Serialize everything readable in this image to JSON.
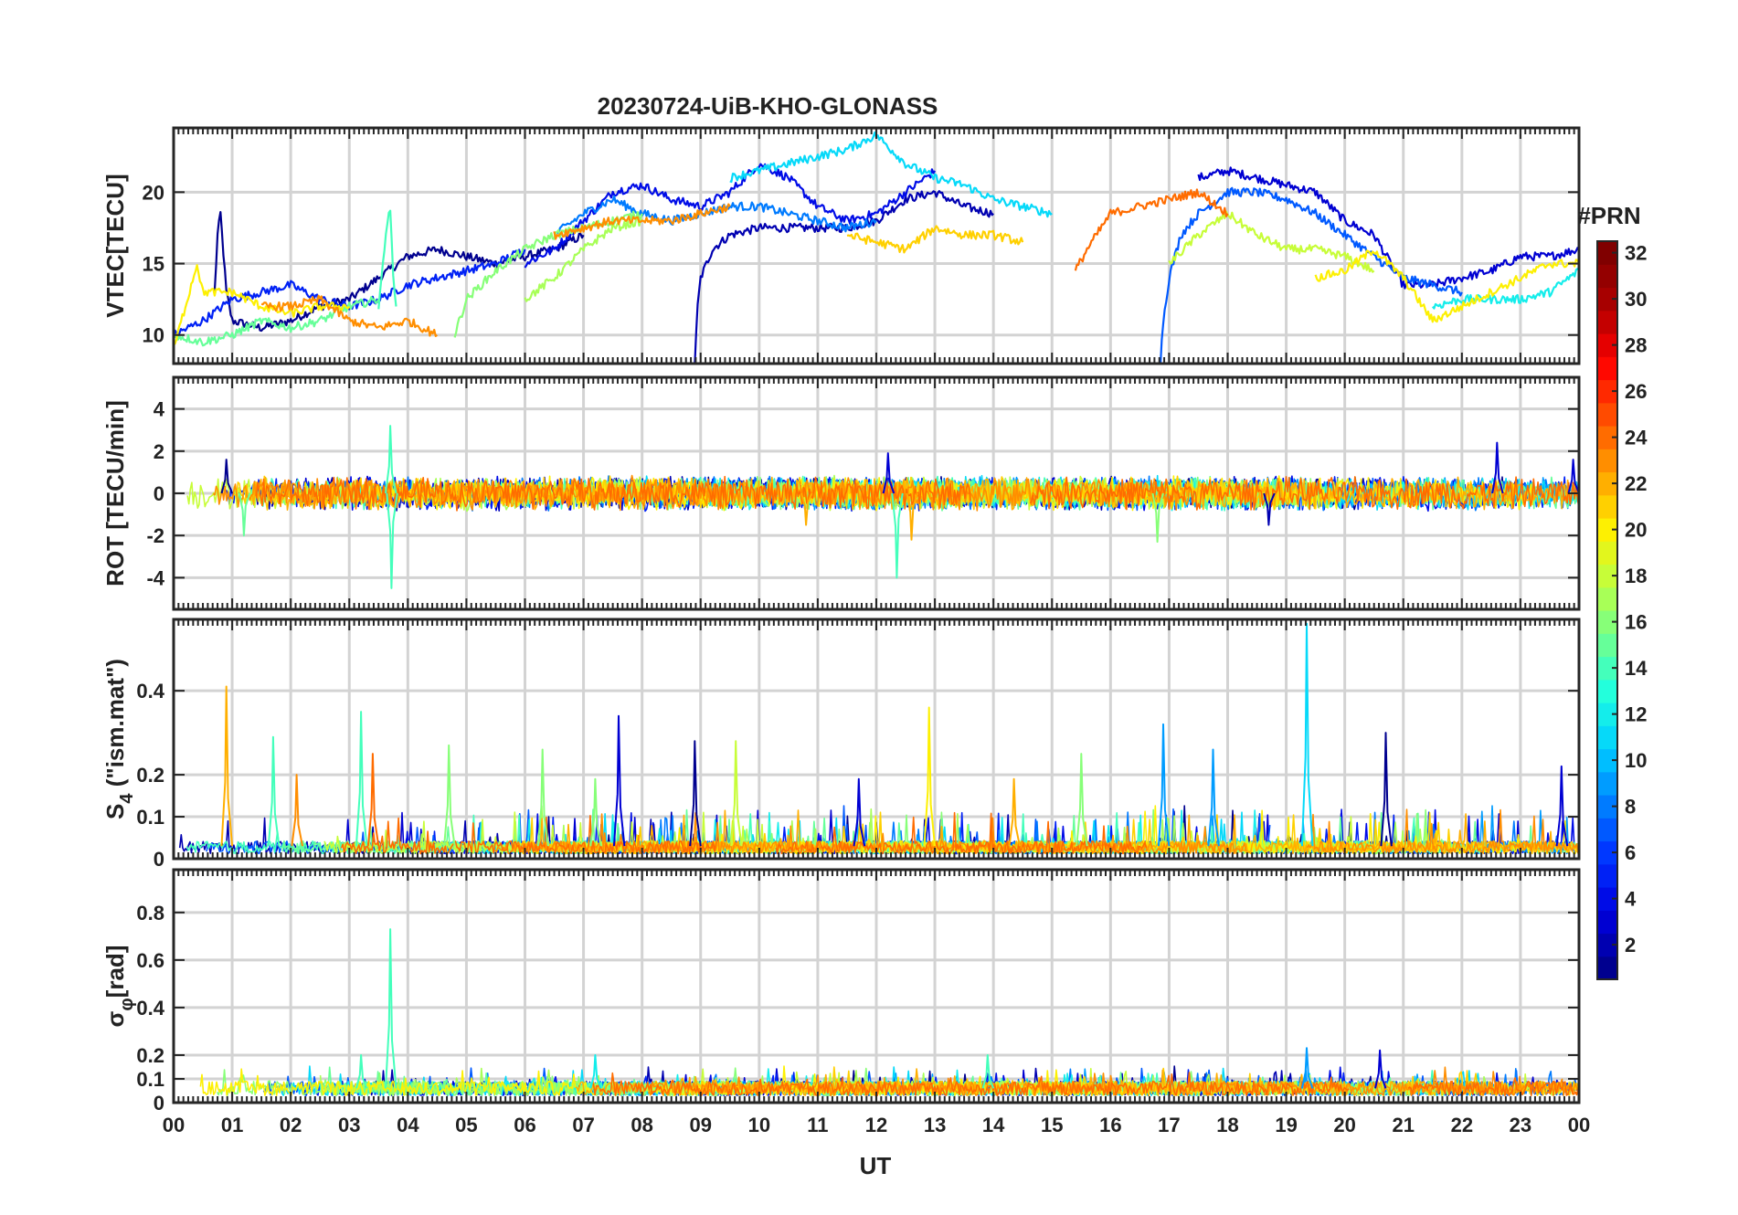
{
  "figure": {
    "title": "20230724-UiB-KHO-GLONASS",
    "xlabel": "UT"
  },
  "colorbar": {
    "title": "#PRN",
    "ticks": [
      2,
      4,
      6,
      8,
      10,
      12,
      14,
      16,
      18,
      20,
      22,
      24,
      26,
      28,
      30,
      32
    ],
    "range": [
      1,
      32
    ],
    "colormap": "jet",
    "colors": [
      "#00008f",
      "#0000df",
      "#0030ff",
      "#0080ff",
      "#00d0ff",
      "#20ffdf",
      "#70ff8f",
      "#bfff40",
      "#ffef00",
      "#ffa000",
      "#ff5000",
      "#ff0000",
      "#af0000",
      "#800000"
    ]
  },
  "chart_data": [
    {
      "type": "line",
      "panel": "vtec",
      "ylabel": "VTEC[TECU]",
      "xlim": [
        0,
        24
      ],
      "ylim": [
        8,
        24.5
      ],
      "yticks": [
        10,
        15,
        20
      ],
      "xtick_labels": [
        "00",
        "01",
        "02",
        "03",
        "04",
        "05",
        "06",
        "07",
        "08",
        "09",
        "10",
        "11",
        "12",
        "13",
        "14",
        "15",
        "16",
        "17",
        "18",
        "19",
        "20",
        "21",
        "22",
        "23",
        "00"
      ],
      "grid": true,
      "series_note": "multiple satellite arcs colored by PRN",
      "series": [
        {
          "prn": 1,
          "x": [
            0.7,
            0.75,
            0.8,
            0.9,
            1.0,
            1.5,
            2.0,
            2.5,
            3.0,
            3.5,
            4.0,
            4.5,
            5.0,
            5.5,
            6.0,
            6.5,
            7.0
          ],
          "y": [
            13,
            17,
            18.5,
            13,
            11,
            10.5,
            11,
            12,
            12.5,
            14,
            15.5,
            16,
            15.5,
            15,
            15.5,
            16,
            17
          ]
        },
        {
          "prn": 2,
          "x": [
            8.9,
            8.95,
            9.0,
            9.2,
            9.5,
            10,
            10.5,
            11,
            11.5,
            12,
            12.5,
            13,
            13.5,
            14
          ],
          "y": [
            8,
            12,
            14,
            16,
            17,
            17.5,
            17.5,
            17.5,
            17.5,
            18,
            19.5,
            20,
            19,
            18.5
          ]
        },
        {
          "prn": 3,
          "x": [
            17.5,
            18,
            18.5,
            19,
            19.5,
            20,
            20.5,
            21,
            21.5,
            22,
            22.5,
            23,
            23.5,
            24
          ],
          "y": [
            21,
            21.5,
            21,
            20.5,
            20,
            18,
            17,
            13.5,
            13.5,
            14,
            14.5,
            15.5,
            15.5,
            16
          ]
        },
        {
          "prn": 4,
          "x": [
            6,
            6.5,
            7,
            7.5,
            8,
            8.5,
            9,
            9.5,
            10,
            10.5,
            11,
            11.5,
            12,
            12.5,
            13
          ],
          "y": [
            15,
            16,
            18,
            20,
            20.5,
            19.5,
            19,
            20,
            22,
            21,
            19,
            18,
            18.5,
            20,
            21.5
          ]
        },
        {
          "prn": 5,
          "x": [
            0,
            0.5,
            1,
            1.5,
            2,
            2.5,
            3,
            3.5,
            4,
            4.5,
            5,
            5.5,
            6
          ],
          "y": [
            10,
            11,
            12.5,
            13,
            13.5,
            12.5,
            12,
            12.5,
            13.5,
            14,
            14.5,
            15,
            16
          ]
        },
        {
          "prn": 7,
          "x": [
            16.85,
            16.9,
            17,
            17.2,
            17.5,
            18,
            18.5,
            19,
            19.5,
            20,
            20.5,
            21,
            21.5,
            22
          ],
          "y": [
            8,
            11,
            14,
            17,
            18.5,
            20,
            20,
            19.5,
            18.5,
            17,
            15.5,
            14,
            13.5,
            13
          ]
        },
        {
          "prn": 8,
          "x": [
            6.5,
            7,
            7.5,
            8,
            8.5,
            9,
            9.5,
            10,
            10.5,
            11,
            11.5,
            12
          ],
          "y": [
            17,
            18.5,
            19.5,
            18.5,
            18,
            18.5,
            19,
            19,
            18.5,
            18,
            17.5,
            18
          ]
        },
        {
          "prn": 11,
          "x": [
            9.5,
            10,
            10.5,
            11,
            11.5,
            12,
            12.5,
            13,
            13.5,
            14,
            14.5,
            15
          ],
          "y": [
            21,
            21.5,
            22,
            22.5,
            23,
            24,
            22,
            21,
            20.5,
            19.5,
            19,
            18.5
          ]
        },
        {
          "prn": 12,
          "x": [
            21.5,
            22,
            22.5,
            23,
            23.5,
            24
          ],
          "y": [
            12,
            12.5,
            12.5,
            12.5,
            13,
            14.5
          ]
        },
        {
          "prn": 14,
          "x": [
            3.5,
            3.65,
            3.7,
            3.75,
            3.8
          ],
          "y": [
            12,
            18,
            19,
            14,
            12
          ]
        },
        {
          "prn": 15,
          "x": [
            0,
            0.5,
            1,
            1.5,
            2,
            2.5,
            3,
            3.5
          ],
          "y": [
            10,
            9.5,
            10,
            11,
            10.5,
            11,
            12,
            12.5
          ]
        },
        {
          "prn": 16,
          "x": [
            4.8,
            5,
            5.5,
            6,
            6.5,
            7,
            7.5,
            8
          ],
          "y": [
            10,
            12.5,
            14.5,
            16,
            17,
            17.5,
            18,
            18.5
          ]
        },
        {
          "prn": 17,
          "x": [
            6,
            6.5,
            7,
            7.5,
            8
          ],
          "y": [
            12.5,
            14,
            16,
            17.5,
            18
          ]
        },
        {
          "prn": 18,
          "x": [
            17,
            17.5,
            18,
            18.5,
            19,
            19.5,
            20,
            20.5
          ],
          "y": [
            15,
            17,
            18.5,
            17,
            16,
            16,
            15.5,
            14.5
          ]
        },
        {
          "prn": 20,
          "x": [
            0,
            0.2,
            0.4,
            0.5,
            1,
            1.5,
            2,
            2.5,
            3
          ],
          "y": [
            9,
            12,
            15,
            13,
            13,
            12,
            11.5,
            12,
            12
          ]
        },
        {
          "prn": 21,
          "x": [
            11.5,
            12,
            12.5,
            13,
            13.5,
            14,
            14.5
          ],
          "y": [
            17,
            16.5,
            16,
            17.5,
            17,
            17,
            16.5
          ]
        },
        {
          "prn": 23,
          "x": [
            1.5,
            2,
            2.5,
            3,
            3.5,
            4,
            4.5
          ],
          "y": [
            12,
            12,
            12.5,
            11,
            10.5,
            11,
            10
          ]
        },
        {
          "prn": 23,
          "x": [
            6.5,
            7,
            7.5,
            8,
            8.5,
            9,
            9.5
          ],
          "y": [
            17,
            17.5,
            18,
            18,
            18,
            18.5,
            19
          ]
        },
        {
          "prn": 24,
          "x": [
            15.4,
            15.6,
            16,
            16.5,
            17,
            17.5,
            18
          ],
          "y": [
            14.5,
            16,
            18.5,
            19,
            19.5,
            20,
            18.5
          ]
        },
        {
          "prn": 20,
          "x": [
            19.5,
            20,
            20.5,
            21,
            21.5,
            22,
            22.5,
            23,
            23.5,
            24
          ],
          "y": [
            14,
            14.5,
            16,
            14,
            11,
            12,
            13,
            14,
            15,
            15
          ]
        }
      ]
    },
    {
      "type": "line",
      "panel": "rot",
      "ylabel": "ROT [TECU/min]",
      "xlim": [
        0,
        24
      ],
      "ylim": [
        -5.5,
        5.5
      ],
      "yticks": [
        -4,
        -2,
        0,
        2,
        4
      ],
      "grid": true,
      "spikes": [
        {
          "x": 3.7,
          "y": 3.2,
          "prn": 14
        },
        {
          "x": 3.72,
          "y": -4.5,
          "prn": 14
        },
        {
          "x": 0.9,
          "y": 1.6,
          "prn": 1
        },
        {
          "x": 1.2,
          "y": -2.0,
          "prn": 15
        },
        {
          "x": 12.2,
          "y": 1.9,
          "prn": 3
        },
        {
          "x": 12.35,
          "y": -4.0,
          "prn": 14
        },
        {
          "x": 12.6,
          "y": -2.2,
          "prn": 22
        },
        {
          "x": 16.8,
          "y": -2.3,
          "prn": 16
        },
        {
          "x": 18.7,
          "y": -1.5,
          "prn": 2
        },
        {
          "x": 22.6,
          "y": 2.4,
          "prn": 3
        },
        {
          "x": 23.9,
          "y": 1.6,
          "prn": 3
        },
        {
          "x": 10.8,
          "y": -1.5,
          "prn": 22
        }
      ]
    },
    {
      "type": "line",
      "panel": "s4",
      "ylabel": "S4 (\"ism.mat\")",
      "ylabel_main": "S",
      "ylabel_sub": "4",
      "ylabel_tail": " (\"ism.mat\")",
      "xlim": [
        0,
        24
      ],
      "ylim": [
        0,
        0.57
      ],
      "yticks": [
        0,
        0.1,
        0.2,
        0.4
      ],
      "ytick_labels": [
        "0",
        "0.1",
        "0.2",
        "0.4"
      ],
      "grid": true,
      "spikes": [
        {
          "x": 0.9,
          "y": 0.41,
          "prn": 22
        },
        {
          "x": 1.7,
          "y": 0.29,
          "prn": 14
        },
        {
          "x": 2.1,
          "y": 0.2,
          "prn": 23
        },
        {
          "x": 3.2,
          "y": 0.35,
          "prn": 14
        },
        {
          "x": 3.4,
          "y": 0.25,
          "prn": 24
        },
        {
          "x": 4.7,
          "y": 0.27,
          "prn": 16
        },
        {
          "x": 6.3,
          "y": 0.26,
          "prn": 16
        },
        {
          "x": 7.6,
          "y": 0.34,
          "prn": 3
        },
        {
          "x": 8.9,
          "y": 0.28,
          "prn": 1
        },
        {
          "x": 9.6,
          "y": 0.28,
          "prn": 18
        },
        {
          "x": 12.9,
          "y": 0.36,
          "prn": 20
        },
        {
          "x": 14.35,
          "y": 0.19,
          "prn": 22
        },
        {
          "x": 15.5,
          "y": 0.25,
          "prn": 16
        },
        {
          "x": 16.9,
          "y": 0.32,
          "prn": 9
        },
        {
          "x": 17.75,
          "y": 0.26,
          "prn": 9
        },
        {
          "x": 19.35,
          "y": 0.56,
          "prn": 11
        },
        {
          "x": 20.7,
          "y": 0.3,
          "prn": 1
        },
        {
          "x": 23.7,
          "y": 0.22,
          "prn": 3
        },
        {
          "x": 7.2,
          "y": 0.19,
          "prn": 16
        },
        {
          "x": 11.7,
          "y": 0.19,
          "prn": 3
        }
      ]
    },
    {
      "type": "line",
      "panel": "sigma_phi",
      "ylabel": "σφ[rad]",
      "ylabel_main": "σ",
      "ylabel_sub": "φ",
      "ylabel_tail": "[rad]",
      "xlim": [
        0,
        24
      ],
      "ylim": [
        0,
        0.98
      ],
      "yticks": [
        0,
        0.1,
        0.2,
        0.4,
        0.6,
        0.8
      ],
      "ytick_labels": [
        "0",
        "0.1",
        "0.2",
        "0.4",
        "0.6",
        "0.8"
      ],
      "grid": true,
      "spikes": [
        {
          "x": 3.7,
          "y": 0.73,
          "prn": 14
        },
        {
          "x": 3.2,
          "y": 0.2,
          "prn": 14
        },
        {
          "x": 19.35,
          "y": 0.23,
          "prn": 9
        },
        {
          "x": 20.6,
          "y": 0.22,
          "prn": 3
        },
        {
          "x": 13.9,
          "y": 0.2,
          "prn": 14
        },
        {
          "x": 7.2,
          "y": 0.2,
          "prn": 12
        }
      ]
    }
  ]
}
